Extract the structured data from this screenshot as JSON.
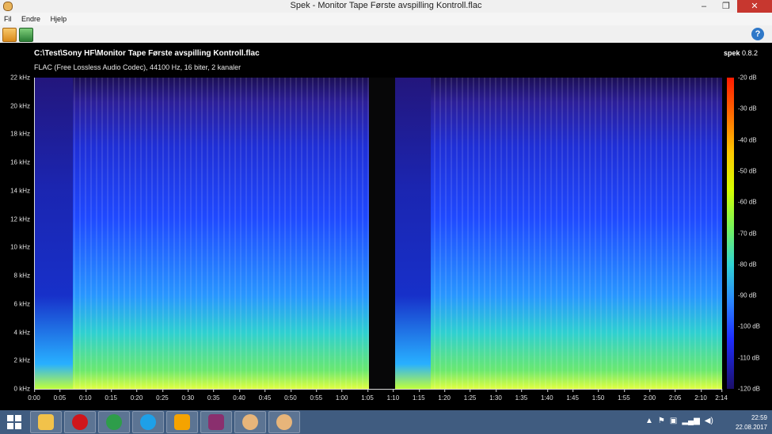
{
  "window": {
    "title": "Spek - Monitor Tape Første avspilling Kontroll.flac",
    "controls": {
      "minimize": "‒",
      "maximize": "❐",
      "close": "✕"
    }
  },
  "menu": {
    "items": [
      "Fil",
      "Endre",
      "Hjelp"
    ]
  },
  "toolbar": {
    "open_icon": "folder-open-icon",
    "save_icon": "save-image-icon",
    "help_icon": "help-icon",
    "help_label": "?"
  },
  "file": {
    "path": "C:\\Test\\Sony HF\\Monitor Tape Første avspilling Kontroll.flac",
    "info": "FLAC (Free Lossless Audio Codec), 44100 Hz, 16 biter, 2 kanaler"
  },
  "brand": {
    "name": "spek",
    "version": "0.8.2"
  },
  "axes": {
    "y_labels": [
      "22 kHz",
      "20 kHz",
      "18 kHz",
      "16 kHz",
      "14 kHz",
      "12 kHz",
      "10 kHz",
      "8 kHz",
      "6 kHz",
      "4 kHz",
      "2 kHz",
      "0 kHz"
    ],
    "x_labels": [
      "0:00",
      "0:05",
      "0:10",
      "0:15",
      "0:20",
      "0:25",
      "0:30",
      "0:35",
      "0:40",
      "0:45",
      "0:50",
      "0:55",
      "1:00",
      "1:05",
      "1:10",
      "1:15",
      "1:20",
      "1:25",
      "1:30",
      "1:35",
      "1:40",
      "1:45",
      "1:50",
      "1:55",
      "2:00",
      "2:05",
      "2:10",
      "2:14"
    ],
    "db_labels": [
      "-20 dB",
      "-30 dB",
      "-40 dB",
      "-50 dB",
      "-60 dB",
      "-70 dB",
      "-80 dB",
      "-90 dB",
      "-100 dB",
      "-110 dB",
      "-120 dB"
    ]
  },
  "taskbar": {
    "apps": [
      "file-explorer-icon",
      "opera-icon",
      "chrome-icon",
      "skype-icon",
      "audio-player-icon",
      "winrar-icon",
      "spek-icon",
      "spek-icon"
    ],
    "tray_icons": [
      "▲",
      "⚑",
      "▣",
      "▂▄▆",
      "◀)"
    ],
    "time": "22:59",
    "date": "22.08.2017"
  },
  "colors": {
    "taskbar": "#405c80",
    "close": "#c7372f"
  }
}
